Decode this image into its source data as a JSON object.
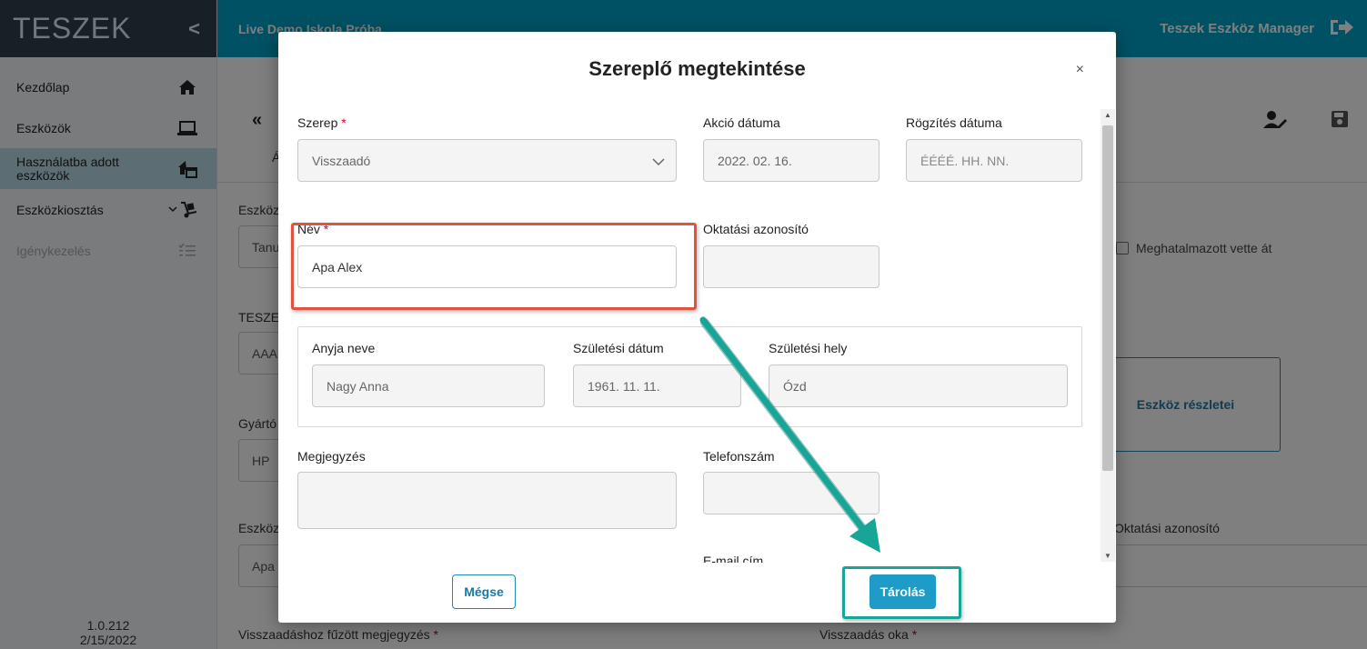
{
  "sidebar": {
    "logo": "TESZEK",
    "collapse": "<",
    "items": [
      {
        "label": "Kezdőlap",
        "icon": "home-icon"
      },
      {
        "label": "Eszközök",
        "icon": "laptop-icon"
      },
      {
        "label": "Használatba adott eszközök",
        "icon": "house-assign-icon"
      },
      {
        "label": "Eszközkiosztás",
        "icon": "hand-truck-icon"
      },
      {
        "label": "Igénykezelés",
        "icon": "checklist-icon"
      }
    ],
    "version": "1.0.212",
    "version_date": "2/15/2022"
  },
  "topbar": {
    "school": "Live Demo Iskola Próba",
    "app_name": "Teszek Eszköz Manager",
    "logout_icon": "logout-icon"
  },
  "background": {
    "back_icon": "«",
    "tab_fragment": "Á",
    "label_eszkoz": "Eszköz",
    "field_tanu": "Tanu",
    "label_teszek": "TESZEK",
    "field_aaa": "AAA",
    "label_gyarto": "Gyártó",
    "field_hp": "HP",
    "label_eszkoz2": "Eszköz",
    "field_apa": "Apa",
    "checkbox_label": "Meghatalmazott vette át",
    "details_button": "Eszköz részletei",
    "oktatasi_label": "Oktatási azonosító",
    "visszaadas_megjegyzes": "Visszaadáshoz fűzött megjegyzés",
    "visszaadas_oka": "Visszaadás oka",
    "required_mark": "*"
  },
  "modal": {
    "title": "Szereplő megtekintése",
    "close": "×",
    "szerep_label": "Szerep",
    "szerep_value": "Visszaadó",
    "akcio_label": "Akció dátuma",
    "akcio_value": "2022. 02. 16.",
    "rogzites_label": "Rögzítés dátuma",
    "rogzites_placeholder": "ÉÉÉÉ. HH. NN.",
    "nev_label": "Név",
    "nev_value": "Apa Alex",
    "oktatasi_label": "Oktatási azonosító",
    "oktatasi_value": "",
    "anyja_label": "Anyja neve",
    "anyja_value": "Nagy Anna",
    "szuletesi_datum_label": "Születési dátum",
    "szuletesi_datum_value": "1961. 11. 11.",
    "szuletesi_hely_label": "Születési hely",
    "szuletesi_hely_value": "Ózd",
    "megjegyzes_label": "Megjegyzés",
    "megjegyzes_value": "",
    "telefon_label": "Telefonszám",
    "telefon_value": "",
    "email_label": "E-mail cím",
    "cancel_label": "Mégse",
    "save_label": "Tárolás",
    "required_mark": "*"
  },
  "colors": {
    "topbar": "#00a3c8",
    "sidebar_header": "#2f3e4e",
    "active_nav": "#b9dbe8",
    "primary_button": "#1e9bc6",
    "highlight_red": "#e0543f",
    "highlight_teal": "#17a597"
  }
}
